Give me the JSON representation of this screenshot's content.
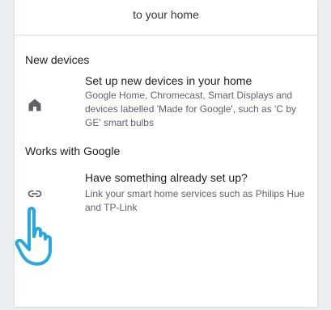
{
  "header": {
    "subtitle": "to your home"
  },
  "sections": [
    {
      "title": "New devices",
      "item": {
        "icon": "home-icon",
        "title": "Set up new devices in your home",
        "description": "Google Home, Chromecast, Smart Displays and devices labelled 'Made for Google', such as 'C by GE' smart bulbs"
      }
    },
    {
      "title": "Works with Google",
      "item": {
        "icon": "link-icon",
        "title": "Have something already set up?",
        "description": "Link your smart home services such as Philips Hue and TP-Link"
      }
    }
  ],
  "overlay": {
    "icon": "pointing-hand-icon",
    "color": "#29a8df"
  }
}
